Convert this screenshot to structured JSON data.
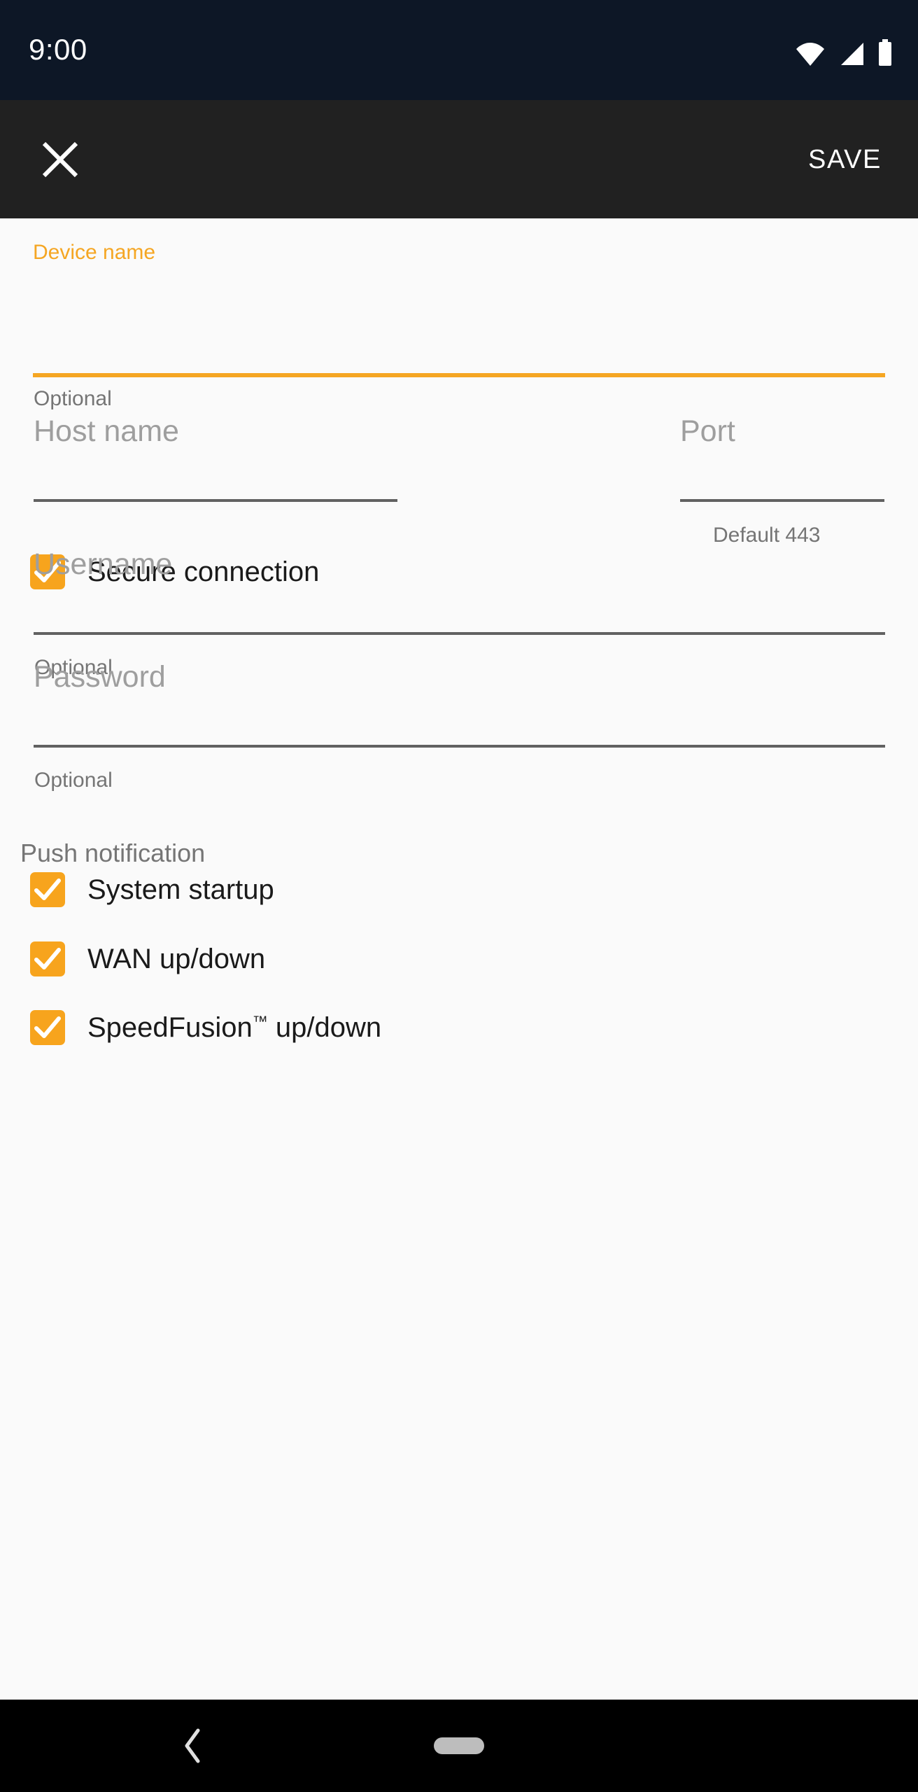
{
  "status_bar": {
    "clock": "9:00",
    "icons": [
      "wifi-icon",
      "cellular-signal-icon",
      "battery-icon"
    ],
    "background_color": "#0D1726"
  },
  "toolbar": {
    "close_icon": "close-icon",
    "save_label": "SAVE",
    "background_color": "#212121"
  },
  "theme": {
    "accent_color": "#F7A41D",
    "page_background": "#FAFAFA",
    "underline_color": "#616161",
    "hint_color": "#9E9E9E",
    "helper_color": "#757575"
  },
  "form": {
    "device_name": {
      "label": "Device name",
      "value": "",
      "placeholder": "",
      "helper": "Optional",
      "focused": true
    },
    "host_name": {
      "label": "Host name",
      "placeholder": "Host name",
      "value": "",
      "helper": ""
    },
    "port": {
      "label": "Port",
      "placeholder": "Port",
      "value": "",
      "helper": "Default 443"
    },
    "secure_connection": {
      "label": "Secure connection",
      "checked": true
    },
    "username": {
      "label": "Username",
      "placeholder": "Username",
      "value": "",
      "helper": "Optional"
    },
    "password": {
      "label": "Password",
      "placeholder": "Password",
      "value": "",
      "helper": "Optional"
    },
    "push_notification": {
      "section_label": "Push notification",
      "items": [
        {
          "label": "System startup",
          "checked": true
        },
        {
          "label": "WAN up/down",
          "checked": true
        },
        {
          "label": "SpeedFusion",
          "suffix": "™",
          "label_tail": " up/down",
          "checked": true
        }
      ]
    }
  },
  "nav_bar": {
    "back_icon": "back-chevron-icon",
    "home_icon": "home-pill-icon"
  }
}
